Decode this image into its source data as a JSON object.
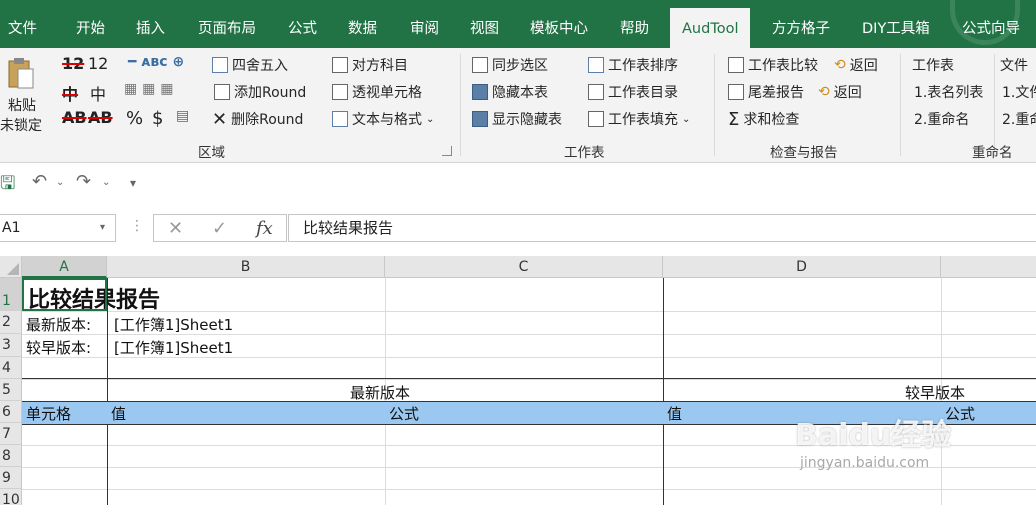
{
  "menu": {
    "tabs": [
      "文件",
      "开始",
      "插入",
      "页面布局",
      "公式",
      "数据",
      "审阅",
      "视图",
      "模板中心",
      "帮助",
      "AudTool",
      "方方格子",
      "DIY工具箱",
      "公式向导"
    ],
    "active": "AudTool"
  },
  "ribbon": {
    "paste": {
      "label1": "粘贴",
      "label2": "未锁定"
    },
    "glyphs": [
      "12",
      "中",
      "AB",
      "%",
      "$"
    ],
    "area_group": {
      "items": [
        "四舍五入",
        "添加Round",
        "删除Round"
      ],
      "label": "区域"
    },
    "area2": {
      "items": [
        "对方科目",
        "透视单元格",
        "文本与格式"
      ]
    },
    "sheet_group": {
      "col1": [
        "同步选区",
        "隐藏本表",
        "显示隐藏表"
      ],
      "col2": [
        "工作表排序",
        "工作表目录",
        "工作表填充"
      ],
      "label": "工作表"
    },
    "check_group": {
      "col1": [
        "工作表比较",
        "尾差报告",
        "求和检查"
      ],
      "col2": [
        "返回",
        "返回"
      ],
      "label": "检查与报告"
    },
    "rename_group": {
      "col1": [
        "工作表",
        "1.表名列表",
        "2.重命名"
      ],
      "col2": [
        "文件",
        "1.文件",
        "2.重命"
      ],
      "label": "重命名"
    }
  },
  "formula_bar": {
    "name_box": "A1",
    "fx": "fx",
    "content": "比较结果报告"
  },
  "sheet": {
    "columns": [
      "A",
      "B",
      "C",
      "D"
    ],
    "rows": [
      "1",
      "2",
      "3",
      "4",
      "5",
      "6",
      "7",
      "8",
      "9",
      "10"
    ],
    "title": "比较结果报告",
    "r2_label": "最新版本:",
    "r2_value": "[工作簿1]Sheet1",
    "r3_label": "较早版本:",
    "r3_value": "[工作簿1]Sheet1",
    "r5_new": "最新版本",
    "r5_old": "较早版本",
    "r6": [
      "单元格",
      "值",
      "公式",
      "值",
      "公式"
    ]
  },
  "watermark": {
    "main": "Baidu经验",
    "sub": "jingyan.baidu.com"
  }
}
